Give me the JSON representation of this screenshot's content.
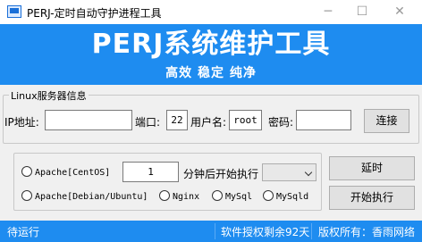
{
  "window": {
    "title": "PERJ-定时自动守护进程工具",
    "minimize_glyph": "─",
    "maximize_glyph": "☐",
    "close_glyph": "✕"
  },
  "banner": {
    "title": "PERJ系统维护工具",
    "subtitle": "高效  稳定  纯净"
  },
  "server": {
    "legend": "Linux服务器信息",
    "ip_label": "IP地址:",
    "ip_value": "",
    "port_label": "端口:",
    "port_value": "22",
    "user_label": "用户名:",
    "user_value": "root",
    "password_label": "密码:",
    "password_value": "",
    "connect_label": "连接"
  },
  "task": {
    "radio_centos": "Apache[CentOS]",
    "minutes_value": "1",
    "minutes_label": "分钟后开始执行",
    "select_value": "",
    "radio_debian": "Apache[Debian/Ubuntu]",
    "radio_nginx": "Nginx",
    "radio_mysql": "MySql",
    "radio_mysqld": "MySqld",
    "delay_label": "延时",
    "start_label": "开始执行"
  },
  "status": {
    "state": "待运行",
    "license": "软件授权剩余92天",
    "copyright": "版权所有：香雨网络"
  },
  "colors": {
    "accent": "#1e8cf0",
    "window_bg": "#f0f0f0"
  }
}
